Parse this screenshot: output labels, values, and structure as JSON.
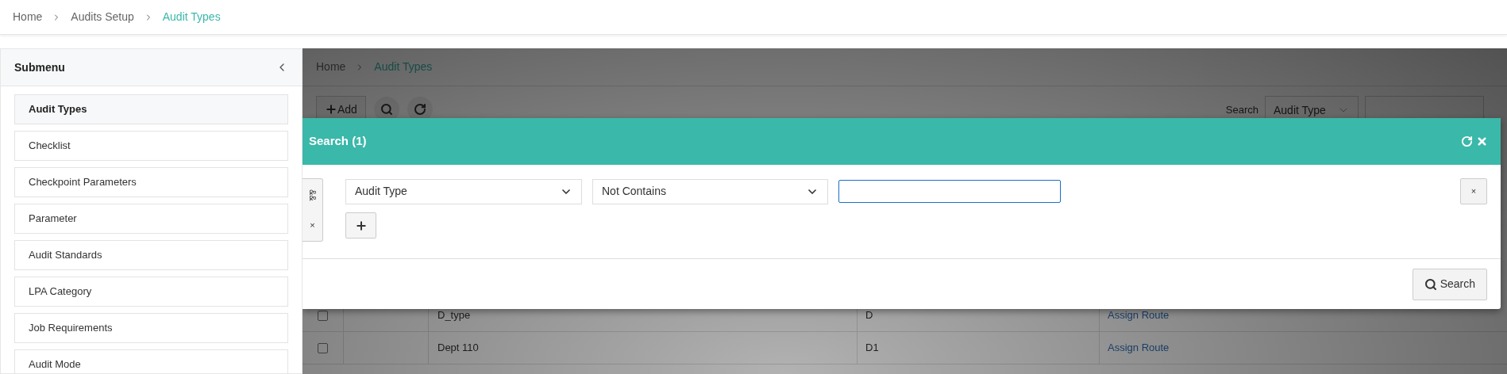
{
  "breadcrumb": [
    {
      "label": "Home",
      "current": false
    },
    {
      "label": "Audits Setup",
      "current": false
    },
    {
      "label": "Audit Types",
      "current": true
    }
  ],
  "sidebar": {
    "title": "Submenu",
    "items": [
      {
        "label": "Audit Types",
        "selected": true
      },
      {
        "label": "Checklist",
        "selected": false
      },
      {
        "label": "Checkpoint Parameters",
        "selected": false
      },
      {
        "label": "Parameter",
        "selected": false
      },
      {
        "label": "Audit Standards",
        "selected": false
      },
      {
        "label": "LPA Category",
        "selected": false
      },
      {
        "label": "Job Requirements",
        "selected": false
      },
      {
        "label": "Audit Mode",
        "selected": false
      }
    ]
  },
  "page": {
    "breadcrumb": [
      {
        "label": "Home",
        "current": false
      },
      {
        "label": "Audit Types",
        "current": true
      }
    ],
    "add_button": "Add",
    "search_label": "Search",
    "search_field": "Audit Type"
  },
  "table": {
    "rows": [
      {
        "checked": false,
        "column_3": "D_type",
        "column_4": "D",
        "column_5": "Assign Route"
      },
      {
        "checked": false,
        "column_3": "Dept 110",
        "column_4": "D1",
        "column_5": "Assign Route"
      }
    ]
  },
  "modal": {
    "title": "Search (1)",
    "operator": "&&",
    "remove_group": "×",
    "conditions": [
      {
        "field": "Audit Type",
        "comparison": "Not Contains",
        "remove": "×"
      }
    ],
    "search_button": "Search"
  }
}
